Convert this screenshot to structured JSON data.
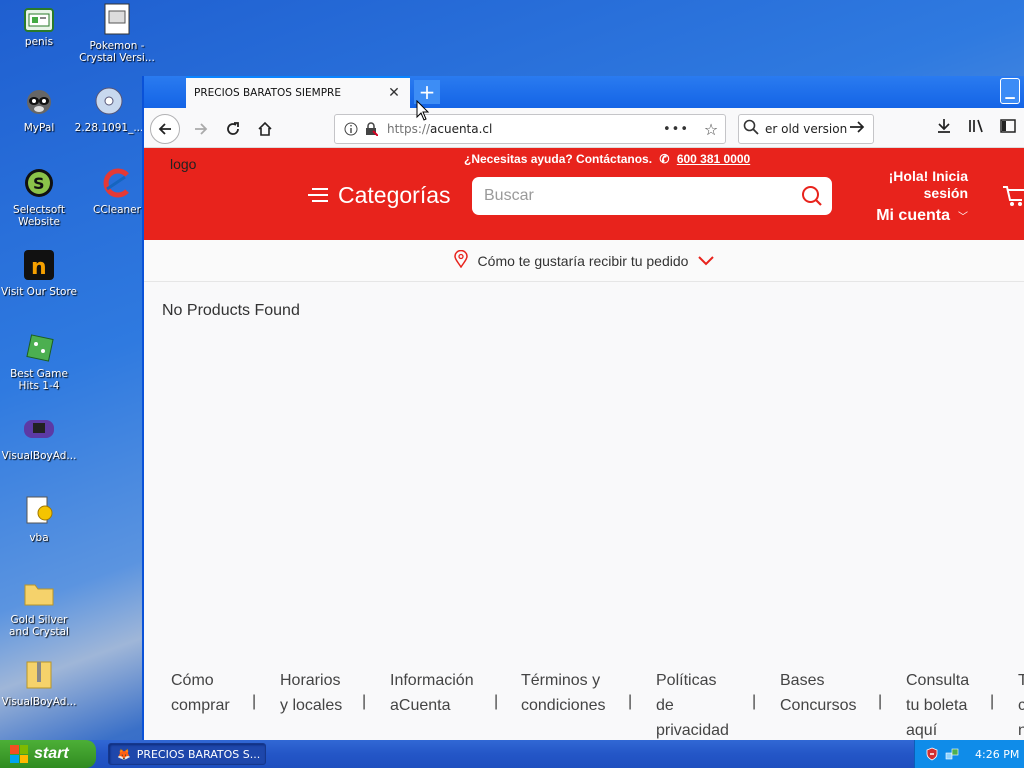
{
  "desktop": {
    "icons": [
      {
        "label": "penis"
      },
      {
        "label": "Pokemon - Crystal Versi..."
      },
      {
        "label": "MyPal"
      },
      {
        "label": "2.28.1091_..."
      },
      {
        "label": "Selectsoft Website"
      },
      {
        "label": "CCleaner"
      },
      {
        "label": "Visit Our Store"
      },
      {
        "label": "Best Game Hits 1-4"
      },
      {
        "label": "VisualBoyAd..."
      },
      {
        "label": "vba"
      },
      {
        "label": "Gold Silver and Crystal"
      },
      {
        "label": "VisualBoyAd..."
      }
    ]
  },
  "browser": {
    "tab_title": "PRECIOS BARATOS SIEMPRE",
    "tab_close": "✕",
    "new_tab": "+",
    "minimize": "▁",
    "url_proto": "https://",
    "url_host": "acuenta.cl",
    "page_actions": "•••",
    "search_text": "er old version"
  },
  "site": {
    "logo": "logo",
    "help_text": "¿Necesitas ayuda? Contáctanos.",
    "phone": "600 381 0000",
    "categories_label": "Categorías",
    "search_placeholder": "Buscar",
    "greeting": "¡Hola! Inicia sesión",
    "account_label": "Mi cuenta",
    "delivery_prompt": "Cómo te gustaría recibir tu pedido",
    "no_products": "No Products Found",
    "footer_links": [
      {
        "line1": "Cómo",
        "line2": "comprar",
        "line3": ""
      },
      {
        "line1": "Horarios",
        "line2": "y locales",
        "line3": ""
      },
      {
        "line1": "Información",
        "line2": "aCuenta",
        "line3": ""
      },
      {
        "line1": "Términos y",
        "line2": "condiciones",
        "line3": ""
      },
      {
        "line1": "Políticas",
        "line2": "de",
        "line3": "privacidad"
      },
      {
        "line1": "Bases",
        "line2": "Concursos",
        "line3": ""
      },
      {
        "line1": "Consulta",
        "line2": "tu boleta",
        "line3": "aquí"
      },
      {
        "line1": "T",
        "line2": "c",
        "line3": "n"
      }
    ],
    "footer_separator": "|"
  },
  "taskbar": {
    "start_label": "start",
    "task_item": "PRECIOS BARATOS S...",
    "clock": "4:26 PM"
  },
  "colors": {
    "brand_red": "#e8231c",
    "xp_blue": "#2456c7",
    "start_green": "#3c9a2a"
  }
}
